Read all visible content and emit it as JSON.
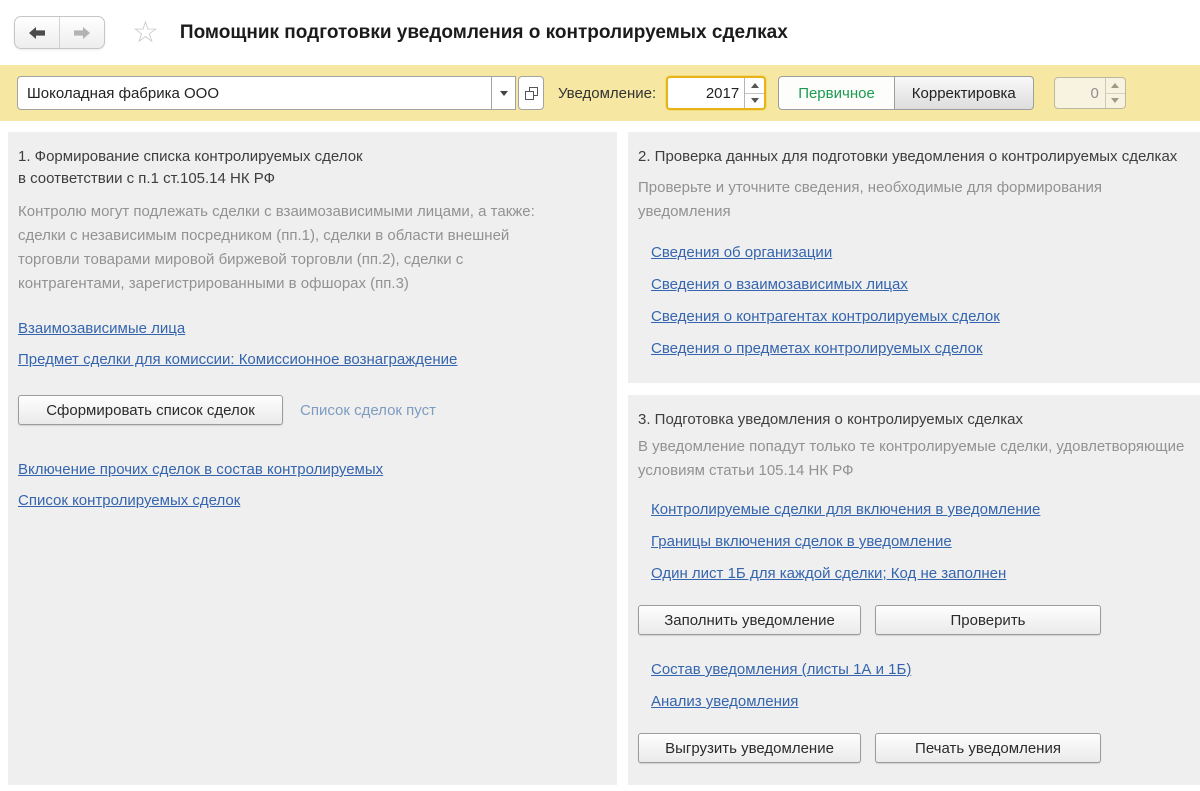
{
  "window": {
    "title": "Помощник подготовки уведомления о контролируемых сделках"
  },
  "icons": {
    "favorite_star": "☆",
    "back_arrow": "←",
    "forward_arrow": "→",
    "dropdown_arrow": "▼",
    "choose_window": "⧉",
    "spin_up": "▲",
    "spin_down": "▼"
  },
  "colors": {
    "toolbar_yellow": "#f6e7a2",
    "focus_gold": "#e8b219",
    "link_blue": "#3565ae",
    "primary_green": "#1b9b51",
    "panel_gray": "#efefef",
    "muted_text": "#929292",
    "note_blue": "#7d9cc0"
  },
  "toolbar": {
    "organization_value": "Шоколадная фабрика ООО",
    "notification_label": "Уведомление:",
    "year_value": "2017",
    "primary_button": "Первичное",
    "correction_button": "Корректировка",
    "correction_number": "0"
  },
  "step1": {
    "title_lines": [
      "1. Формирование списка контролируемых сделок",
      "в соответствии с п.1 ст.105.14 НК РФ"
    ],
    "description": "Контролю могут подлежать сделки с взаимозависимыми лицами, а также: сделки с независимым посредником (пп.1), сделки в области внешней торговли товарами мировой биржевой торговли (пп.2), сделки с контрагентами, зарегистрированными в офшорах (пп.3)",
    "link_interdependent": "Взаимозависимые лица",
    "link_commission_subject": "Предмет сделки для комиссии: Комиссионное вознаграждение",
    "form_list_button": "Сформировать список сделок",
    "empty_list_note": "Список сделок пуст",
    "link_include_other": "Включение прочих сделок в состав контролируемых",
    "link_controlled_list": "Список контролируемых сделок"
  },
  "step2": {
    "title": "2. Проверка данных для подготовки уведомления о контролируемых сделках",
    "description": "Проверьте и уточните сведения, необходимые для формирования уведомления",
    "links": [
      "Сведения об организации",
      "Сведения о взаимозависимых лицах",
      "Сведения о контрагентах контролируемых сделок",
      "Сведения о предметах контролируемых сделок"
    ]
  },
  "step3": {
    "title": "3. Подготовка уведомления о контролируемых сделках",
    "description": "В уведомление попадут только те контролируемые сделки, удовлетворяющие условиям статьи 105.14 НК РФ",
    "links_top": [
      "Контролируемые сделки для включения в уведомление",
      "Границы включения сделок в уведомление",
      "Один лист 1Б для каждой сделки; Код не заполнен"
    ],
    "fill_button": "Заполнить уведомление",
    "check_button": "Проверить",
    "links_bottom": [
      "Состав уведомления (листы 1А и 1Б)",
      "Анализ уведомления"
    ],
    "export_button": "Выгрузить уведомление",
    "print_button": "Печать уведомления"
  }
}
